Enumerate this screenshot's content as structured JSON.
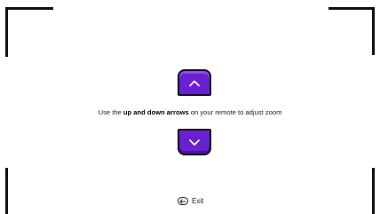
{
  "instruction": {
    "prefix": "Use the ",
    "emphasis": "up and down arrows",
    "suffix": " on your remote to adjust zoom"
  },
  "exit": {
    "label": "Exit",
    "icon": "back-arrow-icon"
  },
  "controls": {
    "up_icon": "chevron-up-icon",
    "down_icon": "chevron-down-icon",
    "accent_color": "#6a1fd0"
  }
}
